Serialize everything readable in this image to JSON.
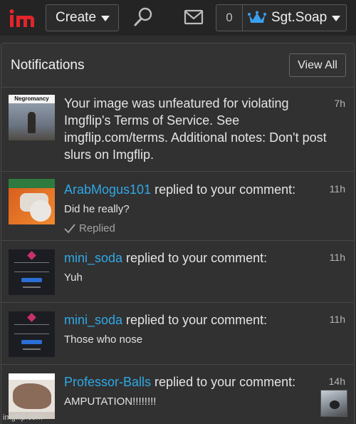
{
  "topbar": {
    "create_label": "Create",
    "notification_count": "0",
    "username": "Sgt.Soap",
    "icons": [
      "imgflip-logo",
      "search-icon",
      "mail-icon",
      "crown-icon"
    ]
  },
  "panel": {
    "title": "Notifications",
    "view_all_label": "View All"
  },
  "notifications": [
    {
      "thumb_caption": "Negromancy",
      "text": "Your image was unfeatured for violating Imgflip's Terms of Service. See imgflip.com/terms. Additional notes: Don't post slurs on Imgflip.",
      "time": "7h"
    },
    {
      "user": "ArabMogus101",
      "action": " replied to your comment:",
      "comment": "Did he really?",
      "status": "Replied",
      "time": "11h"
    },
    {
      "user": "mini_soda",
      "action": " replied to your comment:",
      "comment": "Yuh",
      "time": "11h"
    },
    {
      "user": "mini_soda",
      "action": " replied to your comment:",
      "comment": "Those who nose",
      "time": "11h"
    },
    {
      "user": "Professor-Balls",
      "action": " replied to your comment:",
      "comment": "AMPUTATION!!!!!!!!",
      "time": "14h"
    }
  ],
  "watermark": "imgflip.com",
  "colors": {
    "background": "#2e2e2e",
    "accent_link": "#2fa8e6",
    "logo_red": "#e3242b",
    "crown_blue": "#3aa0f0"
  }
}
